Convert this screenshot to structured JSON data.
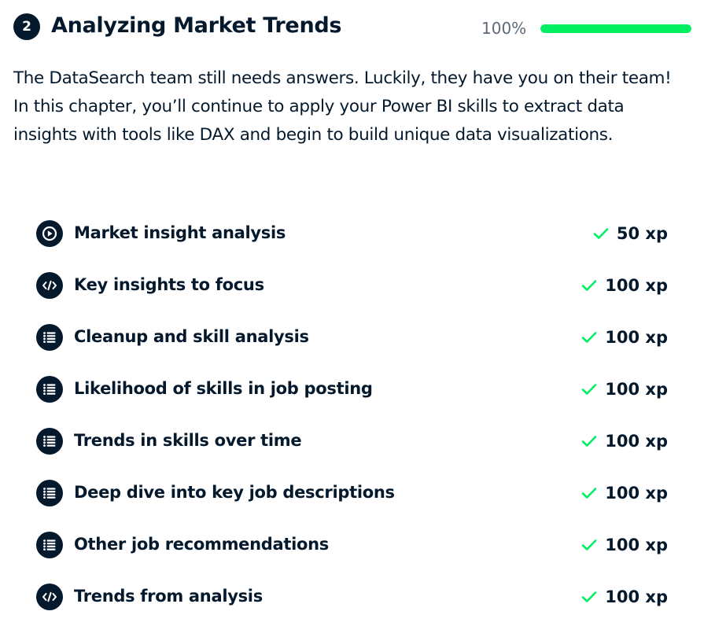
{
  "chapter": {
    "number": "2",
    "title": "Analyzing Market Trends",
    "progress_label": "100%",
    "progress_fraction": 1.0,
    "description": "The DataSearch team still needs answers. Luckily, they have you on their team! In this chapter, you’ll continue to apply your Power BI skills to extract data insights with tools like DAX and begin to build unique data visualizations."
  },
  "colors": {
    "primary_dark": "#05192d",
    "accent_green": "#03ef62",
    "progress_track": "#e8e8ea",
    "muted_text": "#5d6a77"
  },
  "exercises": [
    {
      "title": "Market insight analysis",
      "xp": "50 xp",
      "icon": "video-play-icon",
      "completed": true
    },
    {
      "title": "Key insights to focus",
      "xp": "100 xp",
      "icon": "code-icon",
      "completed": true
    },
    {
      "title": "Cleanup and skill analysis",
      "xp": "100 xp",
      "icon": "list-icon",
      "completed": true
    },
    {
      "title": "Likelihood of skills in job posting",
      "xp": "100 xp",
      "icon": "list-icon",
      "completed": true
    },
    {
      "title": "Trends in skills over time",
      "xp": "100 xp",
      "icon": "list-icon",
      "completed": true
    },
    {
      "title": "Deep dive into key job descriptions",
      "xp": "100 xp",
      "icon": "list-icon",
      "completed": true
    },
    {
      "title": "Other job recommendations",
      "xp": "100 xp",
      "icon": "list-icon",
      "completed": true
    },
    {
      "title": "Trends from analysis",
      "xp": "100 xp",
      "icon": "code-icon",
      "completed": true
    }
  ]
}
